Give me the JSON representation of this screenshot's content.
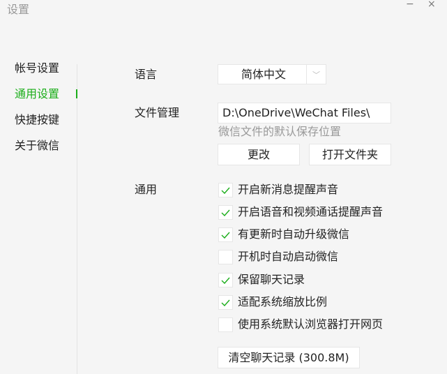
{
  "window": {
    "title": "设置",
    "minimize": "−",
    "close": "×"
  },
  "sidebar": {
    "items": [
      {
        "label": "帐号设置"
      },
      {
        "label": "通用设置",
        "active": true
      },
      {
        "label": "快捷按键"
      },
      {
        "label": "关于微信"
      }
    ]
  },
  "language": {
    "label": "语言",
    "value": "简体中文",
    "arrow": "﹀"
  },
  "files": {
    "label": "文件管理",
    "path": "D:\\OneDrive\\WeChat Files\\",
    "hint": "微信文件的默认保存位置",
    "change": "更改",
    "open_folder": "打开文件夹"
  },
  "general": {
    "label": "通用",
    "options": [
      {
        "label": "开启新消息提醒声音",
        "checked": true
      },
      {
        "label": "开启语音和视频通话提醒声音",
        "checked": true
      },
      {
        "label": "有更新时自动升级微信",
        "checked": true
      },
      {
        "label": "开机时自动启动微信",
        "checked": false
      },
      {
        "label": "保留聊天记录",
        "checked": true
      },
      {
        "label": "适配系统缩放比例",
        "checked": true
      },
      {
        "label": "使用系统默认浏览器打开网页",
        "checked": false
      }
    ],
    "clear": "清空聊天记录 (300.8M)"
  },
  "colors": {
    "accent": "#1aad19",
    "background": "#f5f5f5"
  }
}
